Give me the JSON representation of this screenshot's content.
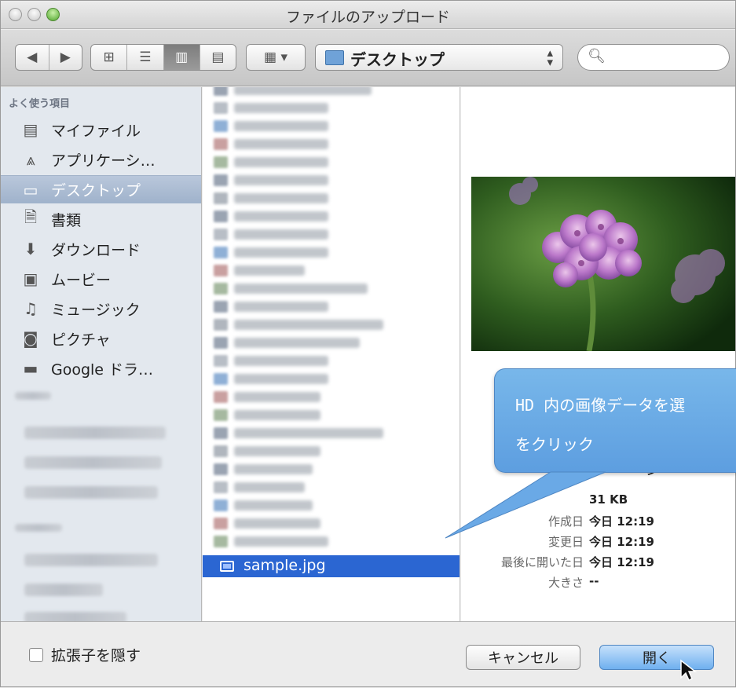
{
  "window": {
    "title": "ファイルのアップロード"
  },
  "toolbar": {
    "back_icon": "chevron-left",
    "forward_icon": "chevron-right",
    "view_icons": [
      "icon-view",
      "list-view",
      "column-view",
      "coverflow-view"
    ],
    "arrange_icon": "arrange",
    "location_label": "デスクトップ",
    "search_placeholder": ""
  },
  "sidebar": {
    "section_label": "よく使う項目",
    "items": [
      {
        "label": "マイファイル",
        "icon": "all-files-icon"
      },
      {
        "label": "アプリケーシ…",
        "icon": "applications-icon"
      },
      {
        "label": "デスクトップ",
        "icon": "desktop-icon",
        "selected": true
      },
      {
        "label": "書類",
        "icon": "documents-icon"
      },
      {
        "label": "ダウンロード",
        "icon": "downloads-icon"
      },
      {
        "label": "ムービー",
        "icon": "movies-icon"
      },
      {
        "label": "ミュージック",
        "icon": "music-icon"
      },
      {
        "label": "ピクチャ",
        "icon": "pictures-icon"
      },
      {
        "label": "Google ドラ…",
        "icon": "folder-icon"
      }
    ]
  },
  "files": {
    "selected_name": "sample.jpg"
  },
  "preview": {
    "kind_partial": "ージ",
    "meta": [
      {
        "key": "",
        "value": "31 KB"
      },
      {
        "key": "作成日",
        "value": "今日 12:19"
      },
      {
        "key": "変更日",
        "value": "今日 12:19"
      },
      {
        "key": "最後に開いた日",
        "value": "今日 12:19"
      },
      {
        "key": "大きさ",
        "value": "--"
      }
    ]
  },
  "callout": {
    "line1": "HD 内の画像データを選",
    "line2": "をクリック"
  },
  "footer": {
    "hide_extension_label": "拡張子を隠す",
    "cancel_label": "キャンセル",
    "open_label": "開く"
  },
  "colors": {
    "selection": "#2b66d2",
    "callout": "#6aa9e6",
    "sidebar": "#e3e8ee"
  }
}
